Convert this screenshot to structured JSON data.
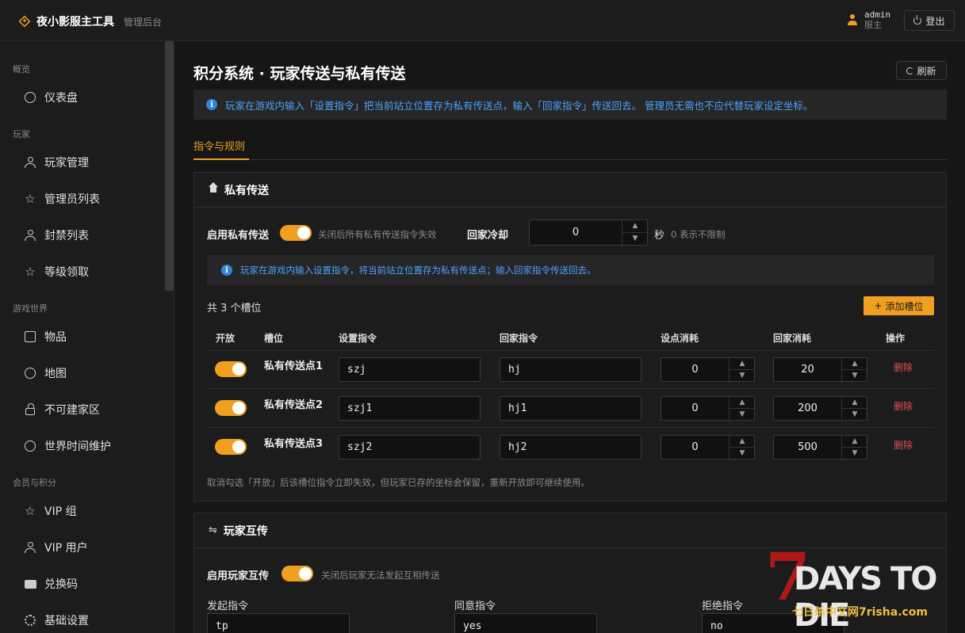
{
  "header": {
    "app_title": "夜小影服主工具",
    "app_subtitle": "管理后台",
    "user_name": "admin",
    "user_role": "服主",
    "logout_label": "登出"
  },
  "sidebar": {
    "groups": [
      {
        "label": "概览",
        "items": [
          {
            "label": "仪表盘",
            "icon": "gauge-icon"
          }
        ]
      },
      {
        "label": "玩家",
        "items": [
          {
            "label": "玩家管理",
            "icon": "user-icon"
          },
          {
            "label": "管理员列表",
            "icon": "star-icon"
          },
          {
            "label": "封禁列表",
            "icon": "user-icon"
          },
          {
            "label": "等级领取",
            "icon": "star-icon"
          }
        ]
      },
      {
        "label": "游戏世界",
        "items": [
          {
            "label": "物品",
            "icon": "box-icon"
          },
          {
            "label": "地图",
            "icon": "map-pin-icon"
          },
          {
            "label": "不可建家区",
            "icon": "lock-icon"
          },
          {
            "label": "世界时间维护",
            "icon": "clock-icon"
          }
        ]
      },
      {
        "label": "会员与积分",
        "items": [
          {
            "label": "VIP 组",
            "icon": "star-icon"
          },
          {
            "label": "VIP 用户",
            "icon": "user-icon"
          },
          {
            "label": "兑换码",
            "icon": "ticket-icon"
          },
          {
            "label": "基础设置",
            "icon": "gear-icon"
          }
        ]
      }
    ]
  },
  "main": {
    "title": "积分系统 · 玩家传送与私有传送",
    "refresh_label": "刷新",
    "info": "玩家在游戏内输入「设置指令」把当前站立位置存为私有传送点，输入「回家指令」传送回去。 管理员无需也不应代替玩家设定坐标。",
    "tab": "指令与规则",
    "private": {
      "title": "私有传送",
      "enable_label": "启用私有传送",
      "enable_on": true,
      "enable_hint": "关闭后所有私有传送指令失效",
      "cooldown_label": "回家冷却",
      "cooldown_value": "0",
      "cooldown_unit": "秒",
      "cooldown_hint": "0 表示不限制",
      "info": "玩家在游戏内输入设置指令，将当前站立位置存为私有传送点；输入回家指令传送回去。",
      "count_label": "共 3 个槽位",
      "add_label": "添加槽位",
      "columns": [
        "开放",
        "槽位",
        "设置指令",
        "回家指令",
        "设点消耗",
        "回家消耗",
        "操作"
      ],
      "rows": [
        {
          "open": true,
          "slot": "私有传送点1",
          "set_cmd": "szj",
          "home_cmd": "hj",
          "set_cost": "0",
          "home_cost": "20",
          "action": "删除"
        },
        {
          "open": true,
          "slot": "私有传送点2",
          "set_cmd": "szj1",
          "home_cmd": "hj1",
          "set_cost": "0",
          "home_cost": "200",
          "action": "删除"
        },
        {
          "open": true,
          "slot": "私有传送点3",
          "set_cmd": "szj2",
          "home_cmd": "hj2",
          "set_cost": "0",
          "home_cost": "500",
          "action": "删除"
        }
      ],
      "footer_note": "取消勾选「开放」后该槽位指令立即失效，但玩家已存的坐标会保留，重新开放即可继续使用。"
    },
    "mutual": {
      "title": "玩家互传",
      "enable_label": "启用玩家互传",
      "enable_on": true,
      "enable_hint": "关闭后玩家无法发起互相传送",
      "request_label": "发起指令",
      "request_value": "tp",
      "accept_label": "同意指令",
      "accept_value": "yes",
      "reject_label": "拒绝指令",
      "reject_value": "no"
    }
  },
  "watermark": {
    "logo": "7 DAYS TO DIE",
    "text": "七日杀中文网7risha.com"
  },
  "colors": {
    "accent": "#f0a020",
    "info": "#4aa3ff",
    "danger": "#e05050",
    "background": "#161616"
  }
}
